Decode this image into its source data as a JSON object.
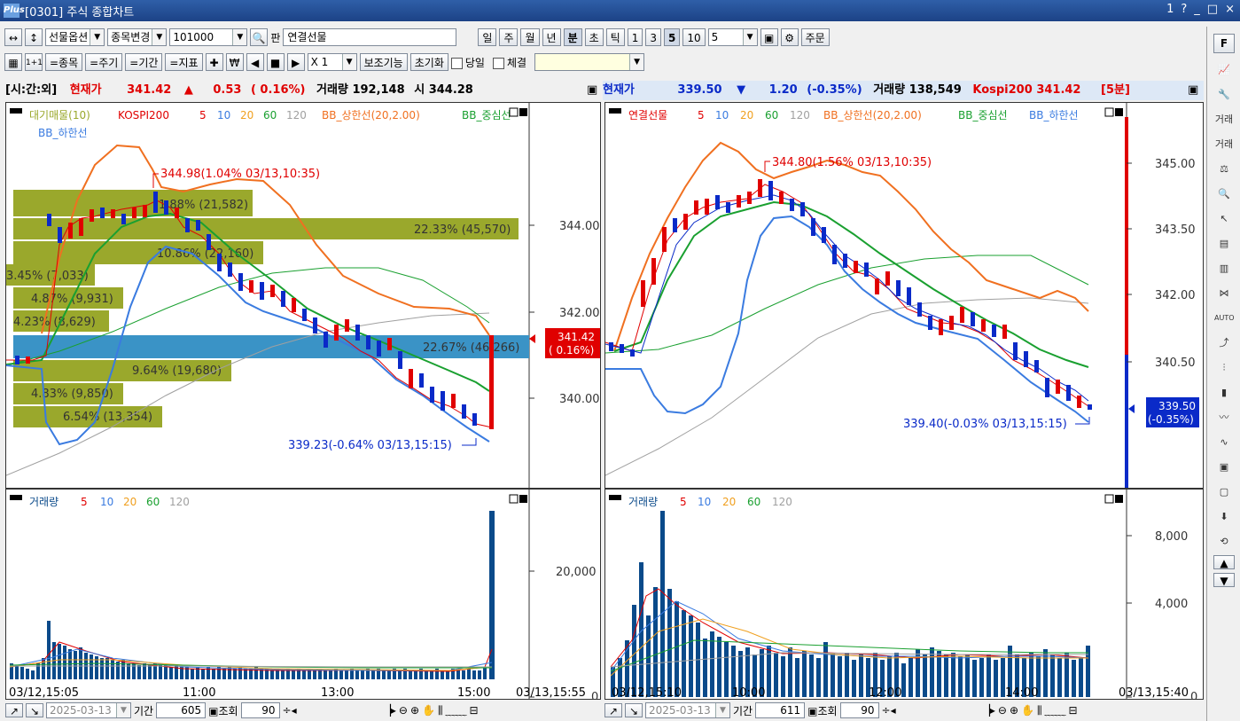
{
  "window": {
    "title": "[0301] 주식 종합차트",
    "logo": "Plus",
    "controls": [
      "1",
      "?",
      "_",
      "□",
      "×"
    ]
  },
  "toolbar1": {
    "select_market": "선물옵션",
    "select_change": "종목변경",
    "code": "101000",
    "pan_label": "판",
    "name": "연결선물",
    "periods": [
      "일",
      "주",
      "월",
      "년",
      "분",
      "초",
      "틱"
    ],
    "active_period": "분",
    "intervals": [
      "1",
      "3",
      "5",
      "10"
    ],
    "active_interval": "5",
    "interval_value": "5",
    "order_label": "주문"
  },
  "toolbar2": {
    "item_label": "=종목",
    "period_label": "=주기",
    "range_label": "=기간",
    "indicator_label": "=지표",
    "multiplier": "X 1",
    "aux_label": "보조기능",
    "reset_label": "초기화",
    "today_label": "당일",
    "fill_label": "체결"
  },
  "left": {
    "info": {
      "mode": "[시:간:외]",
      "price_label": "현재가",
      "price": "341.42",
      "arrow": "▲",
      "change": "0.53",
      "pct": "( 0.16%)",
      "volume_label": "거래량",
      "volume": "192,148",
      "open_label": "시",
      "open": "344.28"
    },
    "legend1": [
      "대기매물(10)",
      "KOSPI200",
      "5",
      "10",
      "20",
      "60",
      "120",
      "BB_상한선(20,2.00)",
      "BB_중심선"
    ],
    "legend2": "BB_하한선",
    "high_note": "344.98(1.04% 03/13,10:35)",
    "low_note": "339.23(-0.64% 03/13,15:15)",
    "price_ticks": [
      "344.00",
      "342.00",
      "340.00"
    ],
    "current_price_box": [
      "341.42",
      "( 0.16%)"
    ],
    "profile_labels": [
      "1.88% (21,582)",
      "22.33% (45,570)",
      "10.86% (22,160)",
      "3.45% (7,033)",
      "4.87% (9,931)",
      "4.23% (8,629)",
      "22.67% (46,266)",
      "9.64% (19,680)",
      "4.83% (9,850)",
      "6.54% (13,354)"
    ],
    "vol_legend": [
      "거래량",
      "5",
      "10",
      "20",
      "60",
      "120"
    ],
    "vol_ticks": [
      "20,000",
      "0"
    ],
    "time_labels": [
      "03/12,15:05",
      "11:00",
      "13:00",
      "15:00",
      "03/13,15:55"
    ],
    "bottom": {
      "date": "2025-03-13",
      "range_label": "기간",
      "range": "605",
      "query_label": "조회",
      "count": "90"
    }
  },
  "right": {
    "info": {
      "price_label": "현재가",
      "price": "339.50",
      "arrow": "▼",
      "change": "1.20",
      "pct": "(-0.35%)",
      "volume_label": "거래량",
      "volume": "138,549",
      "index_label": "Kospi200",
      "index": "341.42",
      "period": "[5분]"
    },
    "legend1": [
      "연결선물",
      "5",
      "10",
      "20",
      "60",
      "120",
      "BB_상한선(20,2.00)",
      "BB_중심선",
      "BB_하한선"
    ],
    "high_note": "344.80(1.56% 03/13,10:35)",
    "low_note": "339.40(-0.03% 03/13,15:15)",
    "price_ticks": [
      "345.00",
      "343.50",
      "342.00",
      "340.50"
    ],
    "current_price_box": [
      "339.50",
      "(-0.35%)"
    ],
    "vol_legend": [
      "거래량",
      "5",
      "10",
      "20",
      "60",
      "120"
    ],
    "vol_ticks": [
      "8,000",
      "4,000",
      "0"
    ],
    "time_labels": [
      "03/12,15:10",
      "10:00",
      "12:00",
      "14:00",
      "03/13,15:40"
    ],
    "bottom": {
      "date": "2025-03-13",
      "range_label": "기간",
      "range": "611",
      "query_label": "조회",
      "count": "90"
    }
  },
  "sidebar": {
    "top_label": "F",
    "tools": [
      "거래",
      "거래",
      "AUTO"
    ]
  },
  "colors": {
    "up": "#e00000",
    "down": "#0a2ac8",
    "olive": "#9aa82c",
    "profile_blue": "#3a93c6",
    "bb_upper": "#f07020",
    "bb_mid": "#1aa030",
    "bb_lower": "#3a7be0"
  }
}
